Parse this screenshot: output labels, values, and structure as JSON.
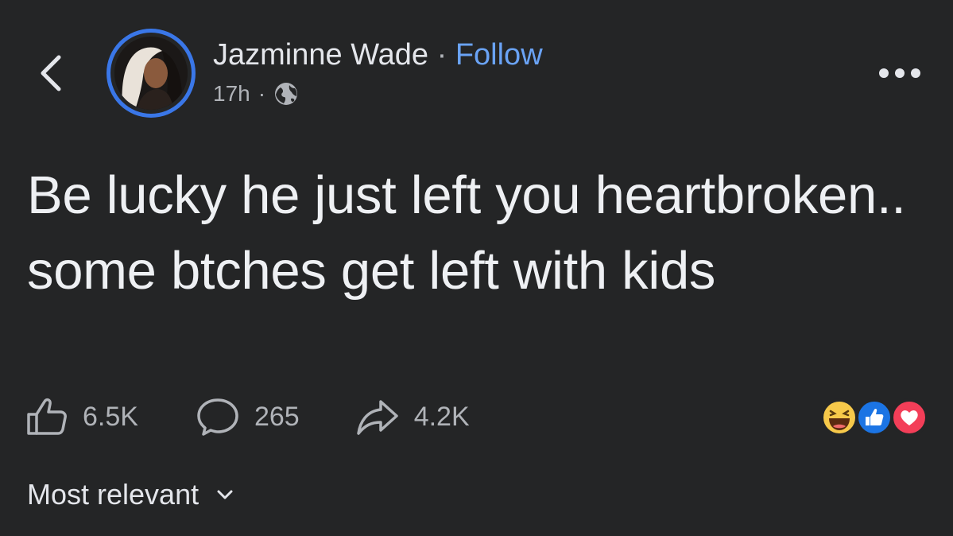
{
  "author": {
    "name": "Jazminne Wade",
    "separator": "·",
    "follow_label": "Follow"
  },
  "meta": {
    "time": "17h",
    "dot": "·",
    "audience_icon": "globe-icon"
  },
  "post": {
    "text": "Be lucky he just left you heartbroken.. some btches get left with kids"
  },
  "actions": {
    "likes": "6.5K",
    "comments": "265",
    "shares": "4.2K"
  },
  "reactions": [
    "haha-emoji-icon",
    "like-reaction-icon",
    "love-reaction-icon"
  ],
  "sort": {
    "label": "Most relevant"
  },
  "colors": {
    "background": "#242526",
    "text": "#e4e6eb",
    "secondary": "#b0b3b8",
    "accent": "#6aa3f5",
    "story_ring": "#3a77e8",
    "like_blue": "#1b74e4",
    "love_red": "#f33e58",
    "haha_yellow": "#f7c94a"
  }
}
